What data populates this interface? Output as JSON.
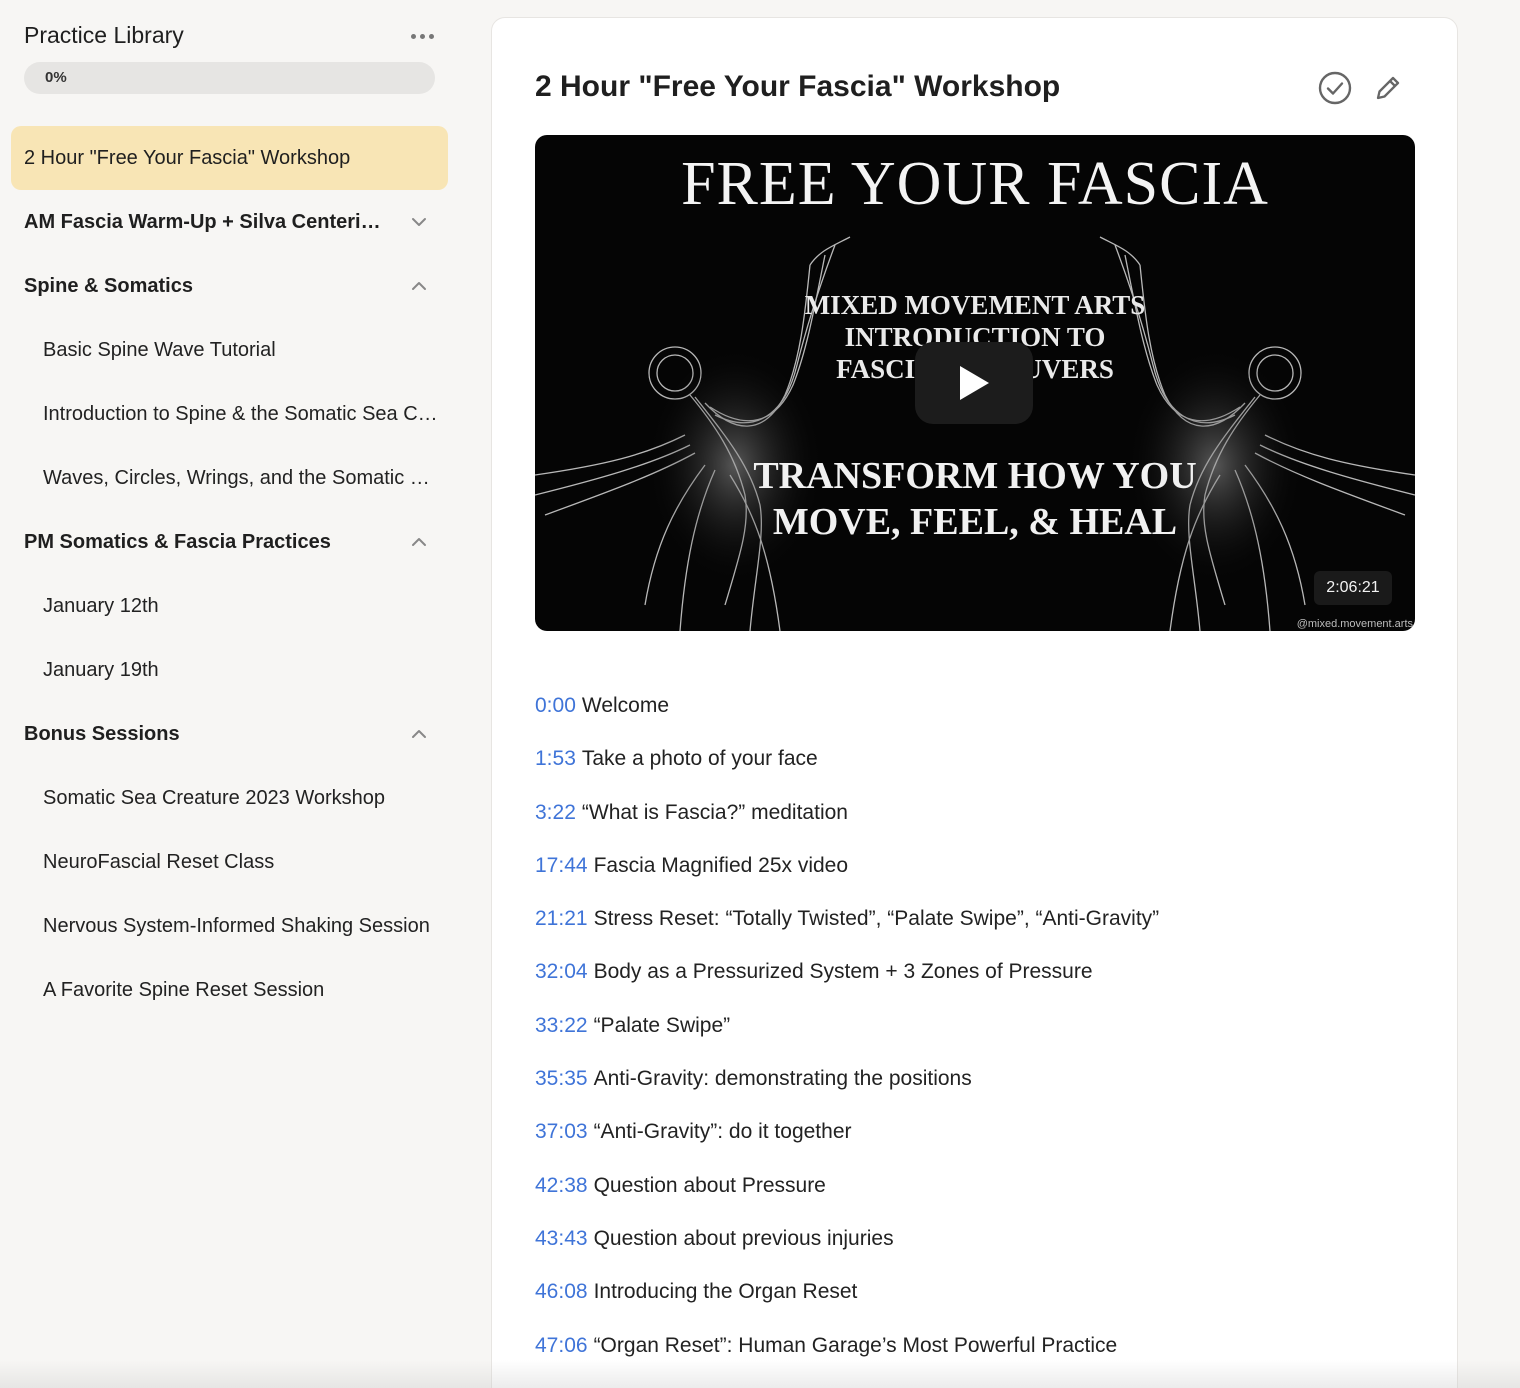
{
  "sidebar": {
    "title": "Practice Library",
    "progress_label": "0%",
    "progress_value": 0,
    "active_item": "2 Hour \"Free Your Fascia\" Workshop",
    "sections": [
      {
        "label": "AM Fascia Warm-Up + Silva Centering",
        "state": "collapsed",
        "items": []
      },
      {
        "label": "Spine & Somatics",
        "state": "expanded",
        "items": [
          "Basic Spine Wave Tutorial",
          "Introduction to Spine & the Somatic Sea Creature",
          "Waves, Circles, Wrings, and the Somatic Sea Creature"
        ]
      },
      {
        "label": "PM Somatics & Fascia Practices",
        "state": "expanded",
        "items": [
          "January 12th",
          "January 19th"
        ]
      },
      {
        "label": "Bonus Sessions",
        "state": "expanded",
        "items": [
          "Somatic Sea Creature 2023 Workshop",
          "NeuroFascial Reset Class",
          "Nervous System-Informed Shaking Session",
          "A Favorite Spine Reset Session"
        ]
      }
    ]
  },
  "main": {
    "title": "2 Hour \"Free Your Fascia\" Workshop",
    "video": {
      "headline": "FREE YOUR FASCIA",
      "subhead": "MIXED MOVEMENT ARTS\nINTRODUCTION TO\nFASCIA MANEUVERS",
      "tagline": "TRANSFORM HOW YOU\nMOVE, FEEL, & HEAL",
      "duration": "2:06:21",
      "watermark": "@mixed.movement.arts"
    },
    "chapters": [
      {
        "time": "0:00",
        "text": "Welcome"
      },
      {
        "time": "1:53",
        "text": "Take a photo of your face"
      },
      {
        "time": "3:22",
        "text": "“What is Fascia?” meditation"
      },
      {
        "time": "17:44",
        "text": "Fascia Magnified 25x video"
      },
      {
        "time": "21:21",
        "text": "Stress Reset: “Totally Twisted”, “Palate Swipe”, “Anti-Gravity”"
      },
      {
        "time": "32:04",
        "text": "Body as a Pressurized System + 3 Zones of Pressure"
      },
      {
        "time": "33:22",
        "text": "“Palate Swipe”"
      },
      {
        "time": "35:35",
        "text": "Anti-Gravity: demonstrating the positions"
      },
      {
        "time": "37:03",
        "text": "“Anti-Gravity”: do it together"
      },
      {
        "time": "42:38",
        "text": "Question about Pressure"
      },
      {
        "time": "43:43",
        "text": "Question about previous injuries"
      },
      {
        "time": "46:08",
        "text": "Introducing the Organ Reset"
      },
      {
        "time": "47:06",
        "text": "“Organ Reset”: Human Garage’s Most Powerful Practice"
      }
    ]
  },
  "colors": {
    "active_bg": "#f8e5b5",
    "timestamp": "#3f74d8",
    "page_bg": "#f7f6f4"
  },
  "icons": {
    "more": "more-dots-icon",
    "expand": "chevron-down-icon",
    "collapse": "chevron-up-icon",
    "complete": "check-circle-icon",
    "edit": "pencil-icon",
    "play": "play-icon"
  }
}
